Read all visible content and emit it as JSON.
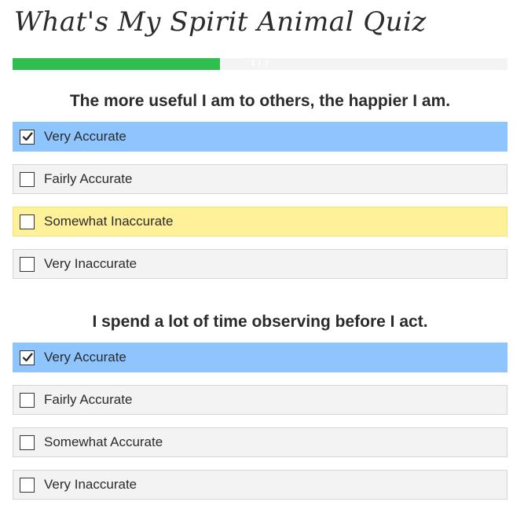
{
  "quiz": {
    "title": "What's My Spirit Animal Quiz"
  },
  "progress": {
    "label": "3 / 7",
    "fraction": 0.419
  },
  "questions": [
    {
      "text": "The more useful I am to others, the happier I am.",
      "options": [
        {
          "label": "Very Accurate",
          "checked": true,
          "state": "selected"
        },
        {
          "label": "Fairly Accurate",
          "checked": false,
          "state": "default"
        },
        {
          "label": "Somewhat Inaccurate",
          "checked": false,
          "state": "highlighted"
        },
        {
          "label": "Very Inaccurate",
          "checked": false,
          "state": "default"
        }
      ]
    },
    {
      "text": "I spend a lot of time observing before I act.",
      "options": [
        {
          "label": "Very Accurate",
          "checked": true,
          "state": "selected"
        },
        {
          "label": "Fairly Accurate",
          "checked": false,
          "state": "default"
        },
        {
          "label": "Somewhat Accurate",
          "checked": false,
          "state": "default"
        },
        {
          "label": "Very Inaccurate",
          "checked": false,
          "state": "default"
        }
      ]
    }
  ],
  "icons": {
    "checked": "checkmark-icon",
    "unchecked": "empty-checkbox-icon"
  },
  "colors": {
    "progress_fill": "#2fbf4f",
    "selected_option": "#8ec5ff",
    "highlighted_option": "#fff09a",
    "default_option": "#f3f3f3"
  }
}
